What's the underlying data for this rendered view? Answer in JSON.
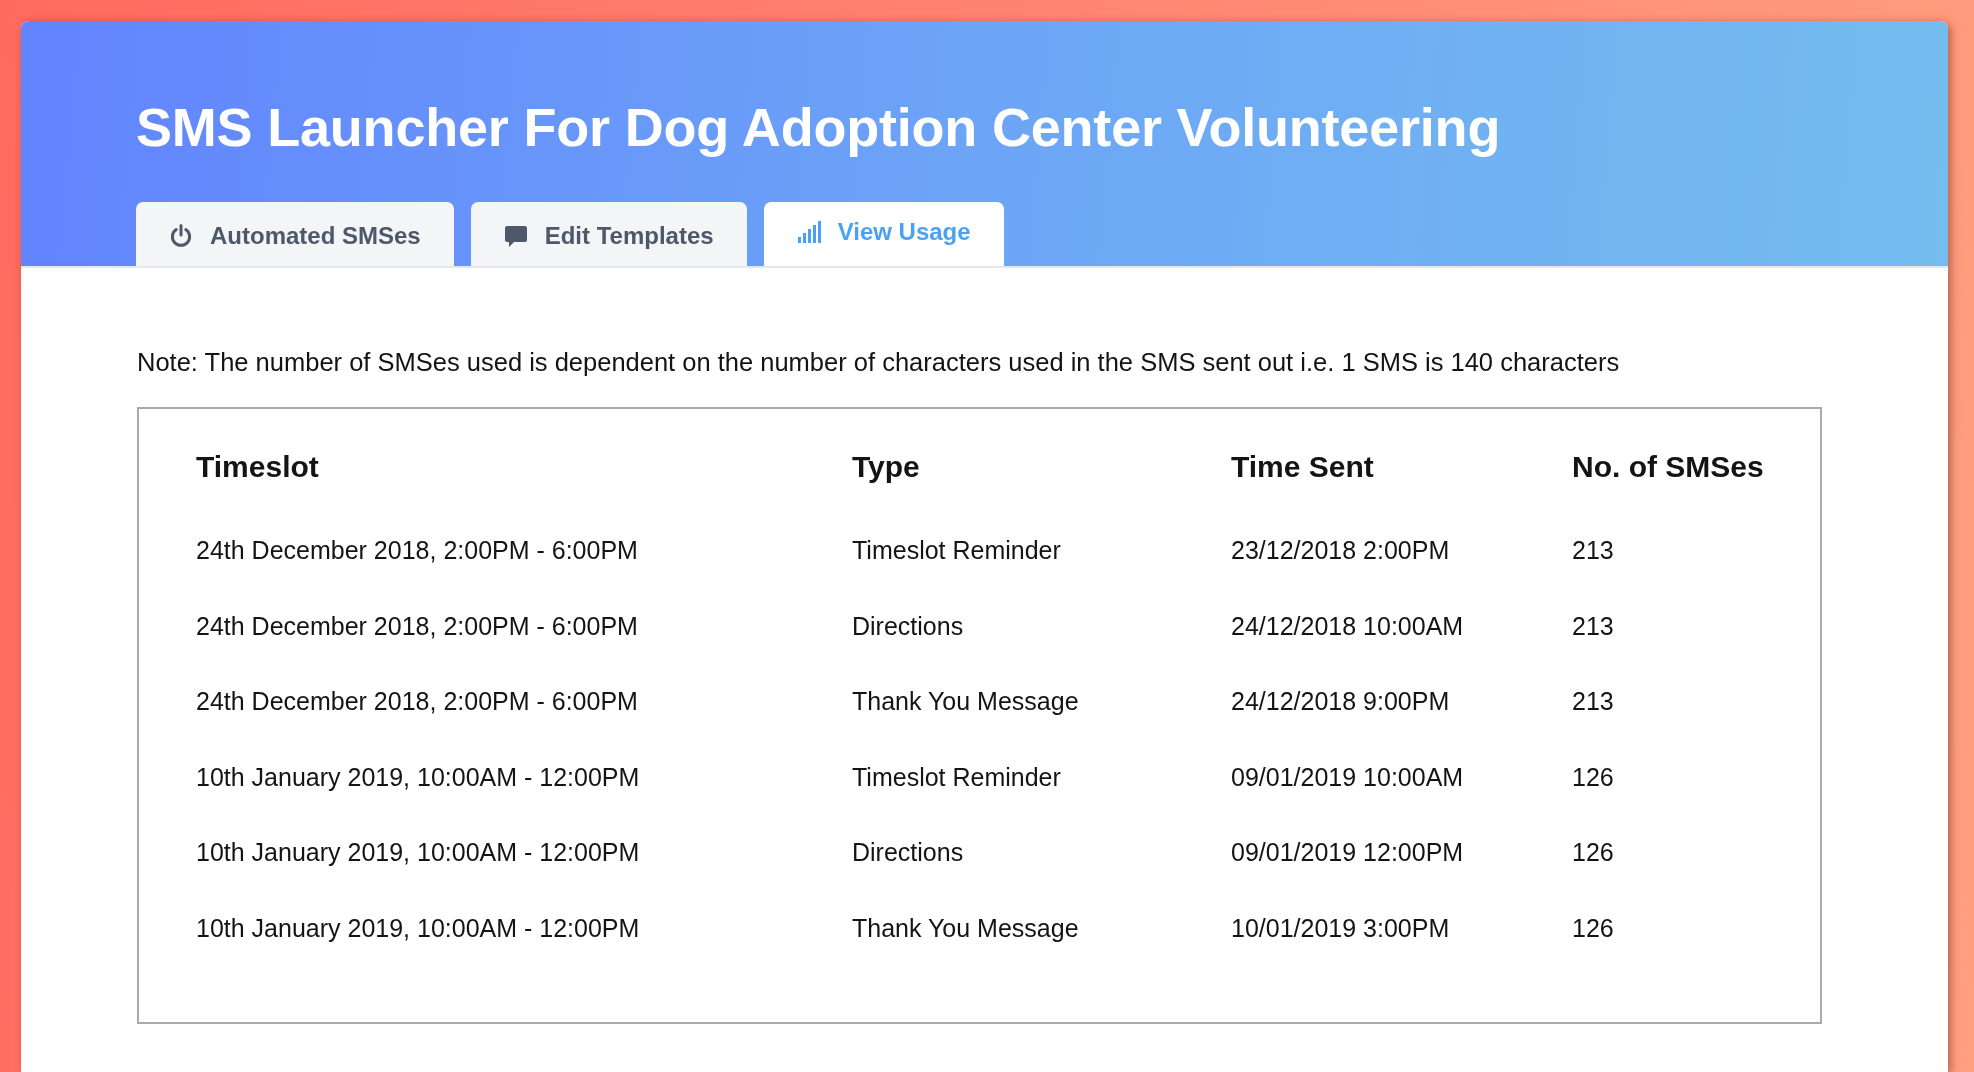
{
  "header": {
    "title": "SMS Launcher For Dog Adoption Center Volunteering"
  },
  "tabs": [
    {
      "label": "Automated SMSes",
      "selected": false
    },
    {
      "label": "Edit Templates",
      "selected": false
    },
    {
      "label": "View Usage",
      "selected": true
    }
  ],
  "note": "Note: The number of SMSes used is dependent on the number of characters used in the SMS sent out i.e. 1 SMS is 140 characters",
  "table": {
    "columns": [
      "Timeslot",
      "Type",
      "Time Sent",
      "No. of SMSes"
    ],
    "rows": [
      [
        "24th December 2018, 2:00PM - 6:00PM",
        "Timeslot Reminder",
        "23/12/2018 2:00PM",
        "213"
      ],
      [
        "24th December 2018, 2:00PM - 6:00PM",
        "Directions",
        "24/12/2018 10:00AM",
        "213"
      ],
      [
        "24th December 2018, 2:00PM - 6:00PM",
        "Thank You Message",
        "24/12/2018 9:00PM",
        "213"
      ],
      [
        "10th January 2019, 10:00AM - 12:00PM",
        "Timeslot Reminder",
        "09/01/2019 10:00AM",
        "126"
      ],
      [
        "10th January 2019, 10:00AM - 12:00PM",
        "Directions",
        "09/01/2019 12:00PM",
        "126"
      ],
      [
        "10th January 2019, 10:00AM - 12:00PM",
        "Thank You Message",
        "10/01/2019 3:00PM",
        "126"
      ]
    ]
  }
}
